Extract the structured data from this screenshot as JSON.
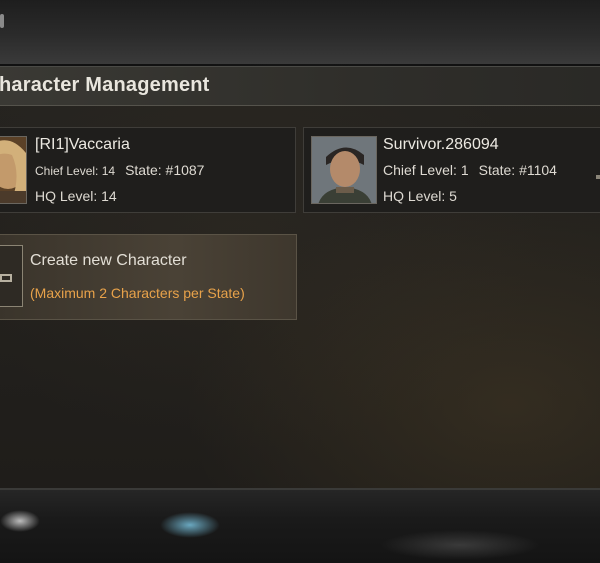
{
  "header": {
    "title": "haracter Management"
  },
  "characters": [
    {
      "name": "[RI1]Vaccaria",
      "chief_level_label": "Chief Level: 14",
      "state_label": "State: #1087",
      "hq_level_label": "HQ Level: 14",
      "avatar_icon": "female-portrait-icon"
    },
    {
      "name": "Survivor.286094",
      "chief_level_label": "Chief Level: 1",
      "state_label": "State: #1104",
      "hq_level_label": "HQ Level: 5",
      "avatar_icon": "male-portrait-icon"
    }
  ],
  "create": {
    "title": "Create new Character",
    "subtitle": "(Maximum 2 Characters per State)",
    "icon": "add-character-icon"
  },
  "colors": {
    "accent": "#e8a24a",
    "text": "#e2ded5",
    "panel": "#1f1d1a"
  }
}
